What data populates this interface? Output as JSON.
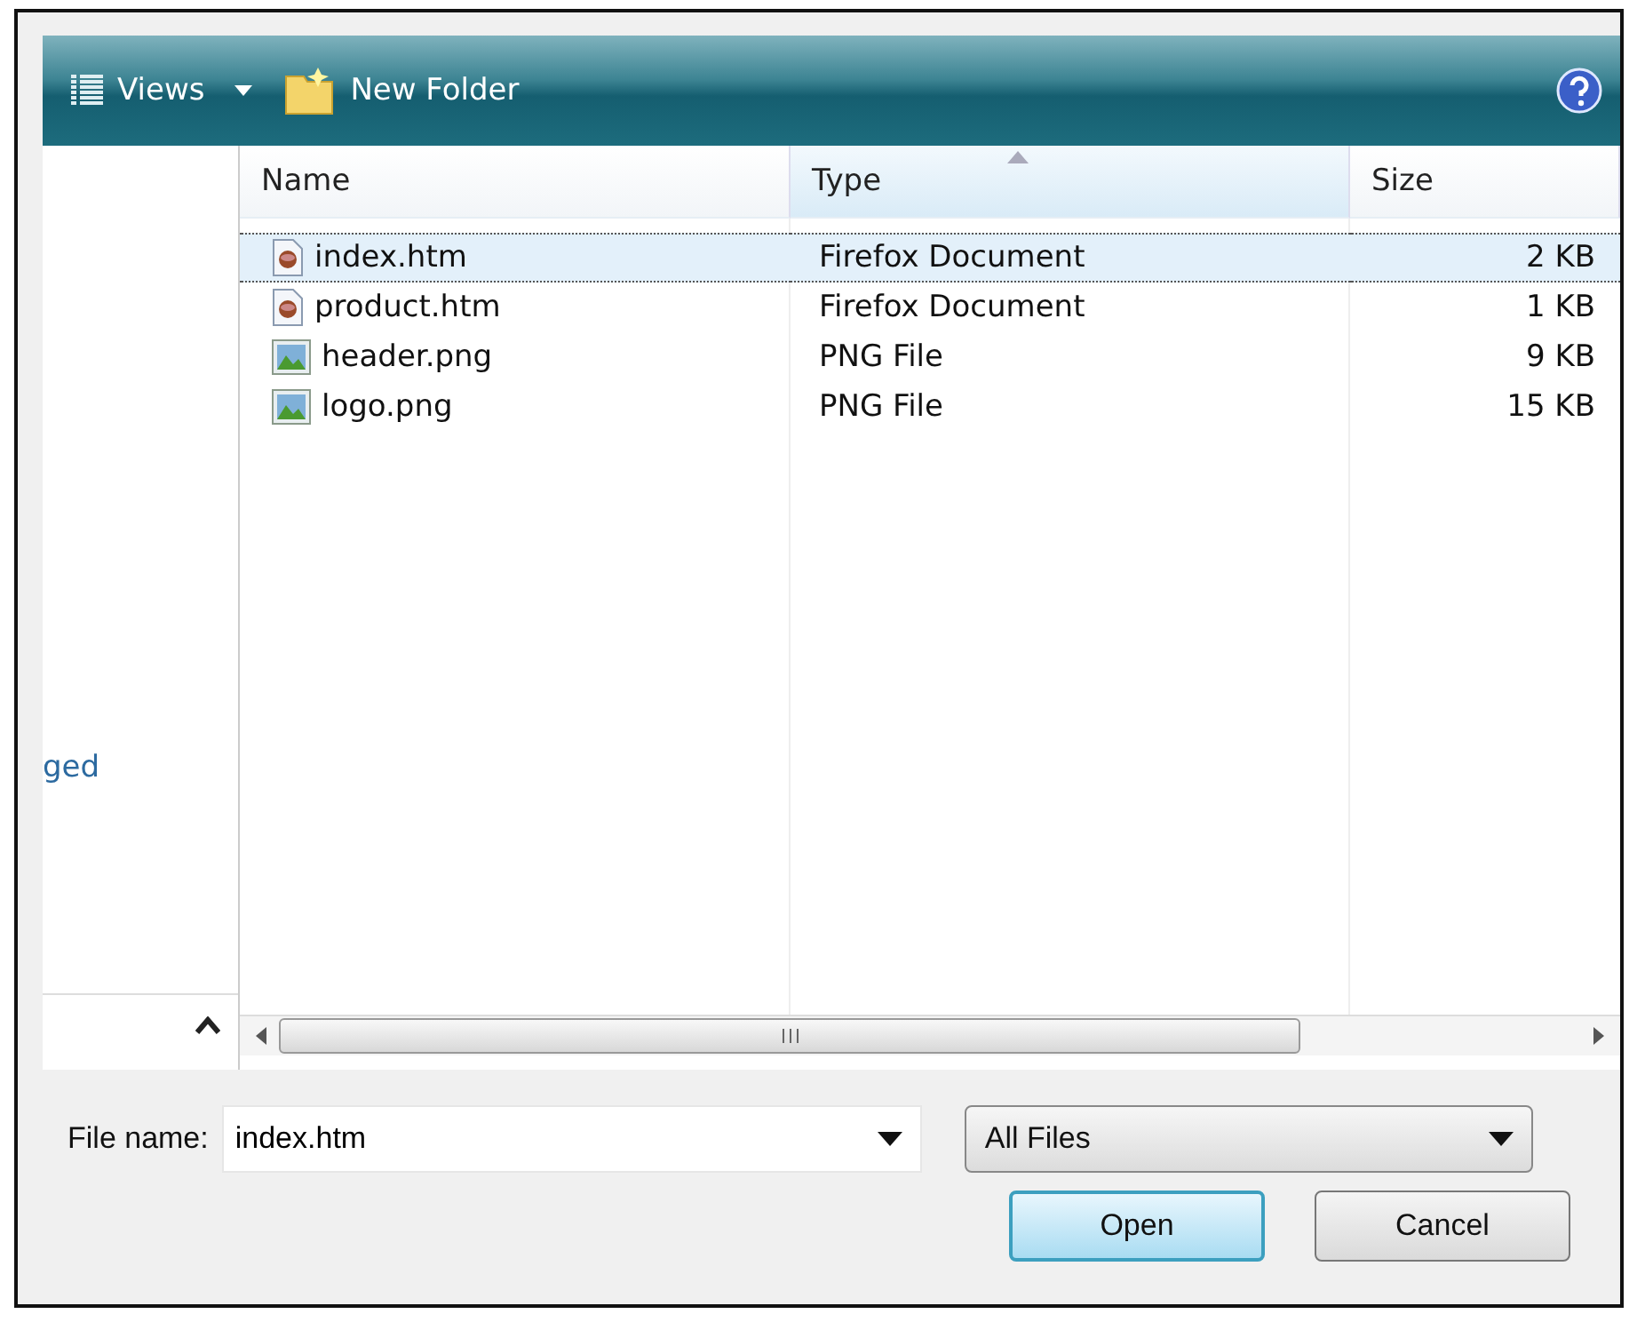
{
  "toolbar": {
    "views": "Views",
    "new_folder": "New Folder"
  },
  "nav_pane": {
    "link": "ged"
  },
  "columns": [
    {
      "label": "Name",
      "sorted": false
    },
    {
      "label": "Type",
      "sorted": true
    },
    {
      "label": "Size",
      "sorted": false
    }
  ],
  "files": [
    {
      "name": "index.htm",
      "type": "Firefox Document",
      "size": "2 KB",
      "kind": "htm",
      "selected": true
    },
    {
      "name": "product.htm",
      "type": "Firefox Document",
      "size": "1 KB",
      "kind": "htm",
      "selected": false
    },
    {
      "name": "header.png",
      "type": "PNG File",
      "size": "9 KB",
      "kind": "png",
      "selected": false
    },
    {
      "name": "logo.png",
      "type": "PNG File",
      "size": "15 KB",
      "kind": "png",
      "selected": false
    }
  ],
  "file_name": {
    "label": "File name:",
    "value": "index.htm"
  },
  "file_type": {
    "value": "All Files"
  },
  "buttons": [
    {
      "label": "Open",
      "default": true
    },
    {
      "label": "Cancel",
      "default": false
    }
  ]
}
